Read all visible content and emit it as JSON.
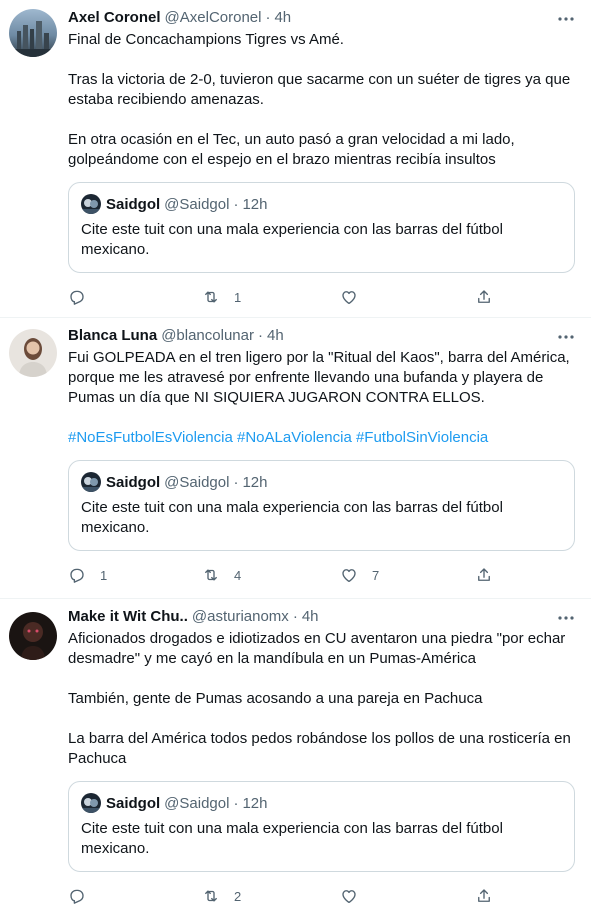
{
  "tweets": [
    {
      "name": "Axel Coronel",
      "handle": "@AxelCoronel",
      "separator": "·",
      "time": "4h",
      "paragraphs": [
        "Final de Concachampions Tigres vs Amé.",
        "Tras la victoria de 2-0, tuvieron que sacarme con un suéter de tigres ya que estaba recibiendo amenazas.",
        "En otra ocasión en el Tec, un auto pasó a gran velocidad a mi lado, golpeándome con el espejo en el brazo mientras recibía insultos"
      ],
      "quote": {
        "name": "Saidgol",
        "handle": "@Saidgol",
        "separator": "·",
        "time": "12h",
        "text": "Cite este tuit con una mala experiencia con las barras del fútbol mexicano."
      },
      "actions": {
        "replies": "",
        "retweets": "1",
        "likes": ""
      }
    },
    {
      "name": "Blanca Luna",
      "handle": "@blancolunar",
      "separator": "·",
      "time": "4h",
      "paragraphs": [
        "Fui GOLPEADA en el tren ligero por la \"Ritual del Kaos\", barra del América, porque me les atravesé por enfrente llevando una bufanda y playera de Pumas un día que NI SIQUIERA JUGARON CONTRA ELLOS."
      ],
      "hashtags": "#NoEsFutbolEsViolencia #NoALaViolencia #FutbolSinViolencia",
      "quote": {
        "name": "Saidgol",
        "handle": "@Saidgol",
        "separator": "·",
        "time": "12h",
        "text": "Cite este tuit con una mala experiencia con las barras del fútbol mexicano."
      },
      "actions": {
        "replies": "1",
        "retweets": "4",
        "likes": "7"
      }
    },
    {
      "name": "Make it Wit Chu..",
      "handle": "@asturianomx",
      "separator": "·",
      "time": "4h",
      "paragraphs": [
        "Aficionados drogados e idiotizados en CU  aventaron una piedra \"por echar desmadre\" y me cayó en la mandíbula en un Pumas-América",
        "También, gente de Pumas acosando a una pareja en Pachuca",
        "La barra del América todos pedos robándose los pollos de una rosticería en Pachuca"
      ],
      "quote": {
        "name": "Saidgol",
        "handle": "@Saidgol",
        "separator": "·",
        "time": "12h",
        "text": "Cite este tuit con una mala experiencia con las barras del fútbol mexicano."
      },
      "actions": {
        "replies": "",
        "retweets": "2",
        "likes": ""
      }
    }
  ],
  "icons": {
    "reply": "reply-icon",
    "retweet": "retweet-icon",
    "like": "heart-icon",
    "share": "share-icon",
    "more": "more-icon"
  },
  "colors": {
    "text": "#0f1419",
    "secondary": "#536471",
    "link": "#1d9bf0",
    "border": "#cfd9de",
    "divider": "#eff3f4"
  }
}
